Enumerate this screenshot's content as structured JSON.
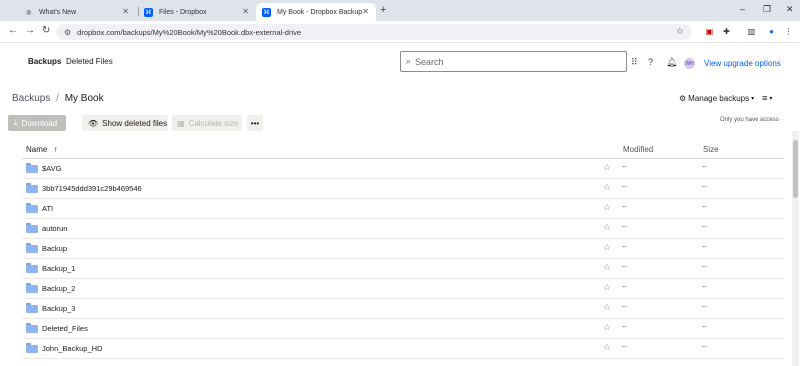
{
  "browser": {
    "tabs": [
      {
        "title": "What's New",
        "icon": "globe-icon"
      },
      {
        "title": "Files - Dropbox",
        "icon": "dropbox-icon"
      },
      {
        "title": "My Book - Dropbox Backup",
        "icon": "dropbox-icon",
        "active": true
      }
    ],
    "url": "dropbox.com/backups/My%20Book/My%20Book.dbx-external-drive"
  },
  "header": {
    "nav": [
      "Backups",
      "Deleted Files"
    ],
    "search_placeholder": "Search",
    "avatar_initials": "WH",
    "upgrade_label": "View upgrade options"
  },
  "breadcrumb": {
    "root": "Backups",
    "separator": "/",
    "current": "My Book"
  },
  "manage_label": "Manage backups",
  "actions": {
    "download": "Download",
    "show_deleted": "Show deleted files",
    "calculate": "Calculate size",
    "more": "•••"
  },
  "access_note": "Only you have access",
  "table": {
    "columns": {
      "name": "Name",
      "modified": "Modified",
      "size": "Size"
    },
    "rows": [
      {
        "name": "$AVG",
        "modified": "--",
        "size": "--"
      },
      {
        "name": "3bb71945ddd391c29b469546",
        "modified": "--",
        "size": "--"
      },
      {
        "name": "ATI",
        "modified": "--",
        "size": "--"
      },
      {
        "name": "autorun",
        "modified": "--",
        "size": "--"
      },
      {
        "name": "Backup",
        "modified": "--",
        "size": "--"
      },
      {
        "name": "Backup_1",
        "modified": "--",
        "size": "--"
      },
      {
        "name": "Backup_2",
        "modified": "--",
        "size": "--"
      },
      {
        "name": "Backup_3",
        "modified": "--",
        "size": "--"
      },
      {
        "name": "Deleted_Files",
        "modified": "--",
        "size": "--"
      },
      {
        "name": "John_Backup_HD",
        "modified": "--",
        "size": "--"
      }
    ]
  },
  "colors": {
    "accent": "#0061fe",
    "folder": "#8fb5ef",
    "tabstrip": "#dfe3ea"
  }
}
